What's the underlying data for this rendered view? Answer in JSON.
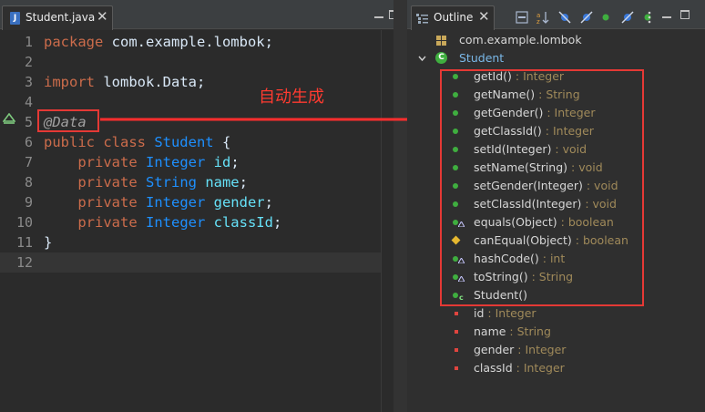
{
  "editor": {
    "tab_label": "Student.java",
    "tab_close": "✕",
    "lines": [
      {
        "n": "1"
      },
      {
        "n": "2"
      },
      {
        "n": "3"
      },
      {
        "n": "4"
      },
      {
        "n": "5"
      },
      {
        "n": "6"
      },
      {
        "n": "7"
      },
      {
        "n": "8"
      },
      {
        "n": "9"
      },
      {
        "n": "10"
      },
      {
        "n": "11"
      },
      {
        "n": "12"
      }
    ],
    "code": {
      "l1_kw": "package",
      "l1_rest": " com.example.lombok;",
      "l3_kw": "import",
      "l3_rest": " lombok.Data;",
      "l5_ann": "@Data",
      "l6_kw": "public class",
      "l6_type": " Student",
      "l6_rest": " {",
      "private": "private",
      "l7_type": " Integer",
      "l7_field": " id",
      "l7_end": ";",
      "l8_type": " String",
      "l8_field": " name",
      "l8_end": ";",
      "l9_type": " Integer",
      "l9_field": " gender",
      "l9_end": ";",
      "l10_type": " Integer",
      "l10_field": " classId",
      "l10_end": ";",
      "l11": "}"
    },
    "annotation_note": "自动生成"
  },
  "outline": {
    "tab_label": "Outline",
    "tab_close": "✕",
    "package": "com.example.lombok",
    "class_name": "Student",
    "methods": [
      {
        "name": "getId()",
        "type": " : Integer"
      },
      {
        "name": "getName()",
        "type": " : String"
      },
      {
        "name": "getGender()",
        "type": " : Integer"
      },
      {
        "name": "getClassId()",
        "type": " : Integer"
      },
      {
        "name": "setId(Integer)",
        "type": " : void"
      },
      {
        "name": "setName(String)",
        "type": " : void"
      },
      {
        "name": "setGender(Integer)",
        "type": " : void"
      },
      {
        "name": "setClassId(Integer)",
        "type": " : void"
      },
      {
        "name": "equals(Object)",
        "type": " : boolean"
      },
      {
        "name": "canEqual(Object)",
        "type": " : boolean"
      },
      {
        "name": "hashCode()",
        "type": " : int"
      },
      {
        "name": "toString()",
        "type": " : String"
      },
      {
        "name": "Student()",
        "type": ""
      }
    ],
    "fields": [
      {
        "name": "id",
        "type": " : Integer"
      },
      {
        "name": "name",
        "type": " : String"
      },
      {
        "name": "gender",
        "type": " : Integer"
      },
      {
        "name": "classId",
        "type": " : Integer"
      }
    ]
  },
  "colors": {
    "keyword": "#cc6c4b",
    "type": "#1e90ff",
    "field": "#66e1f8",
    "highlight_box": "#e53935",
    "public_method": "#3fae3f",
    "private_field": "#e0453f"
  }
}
